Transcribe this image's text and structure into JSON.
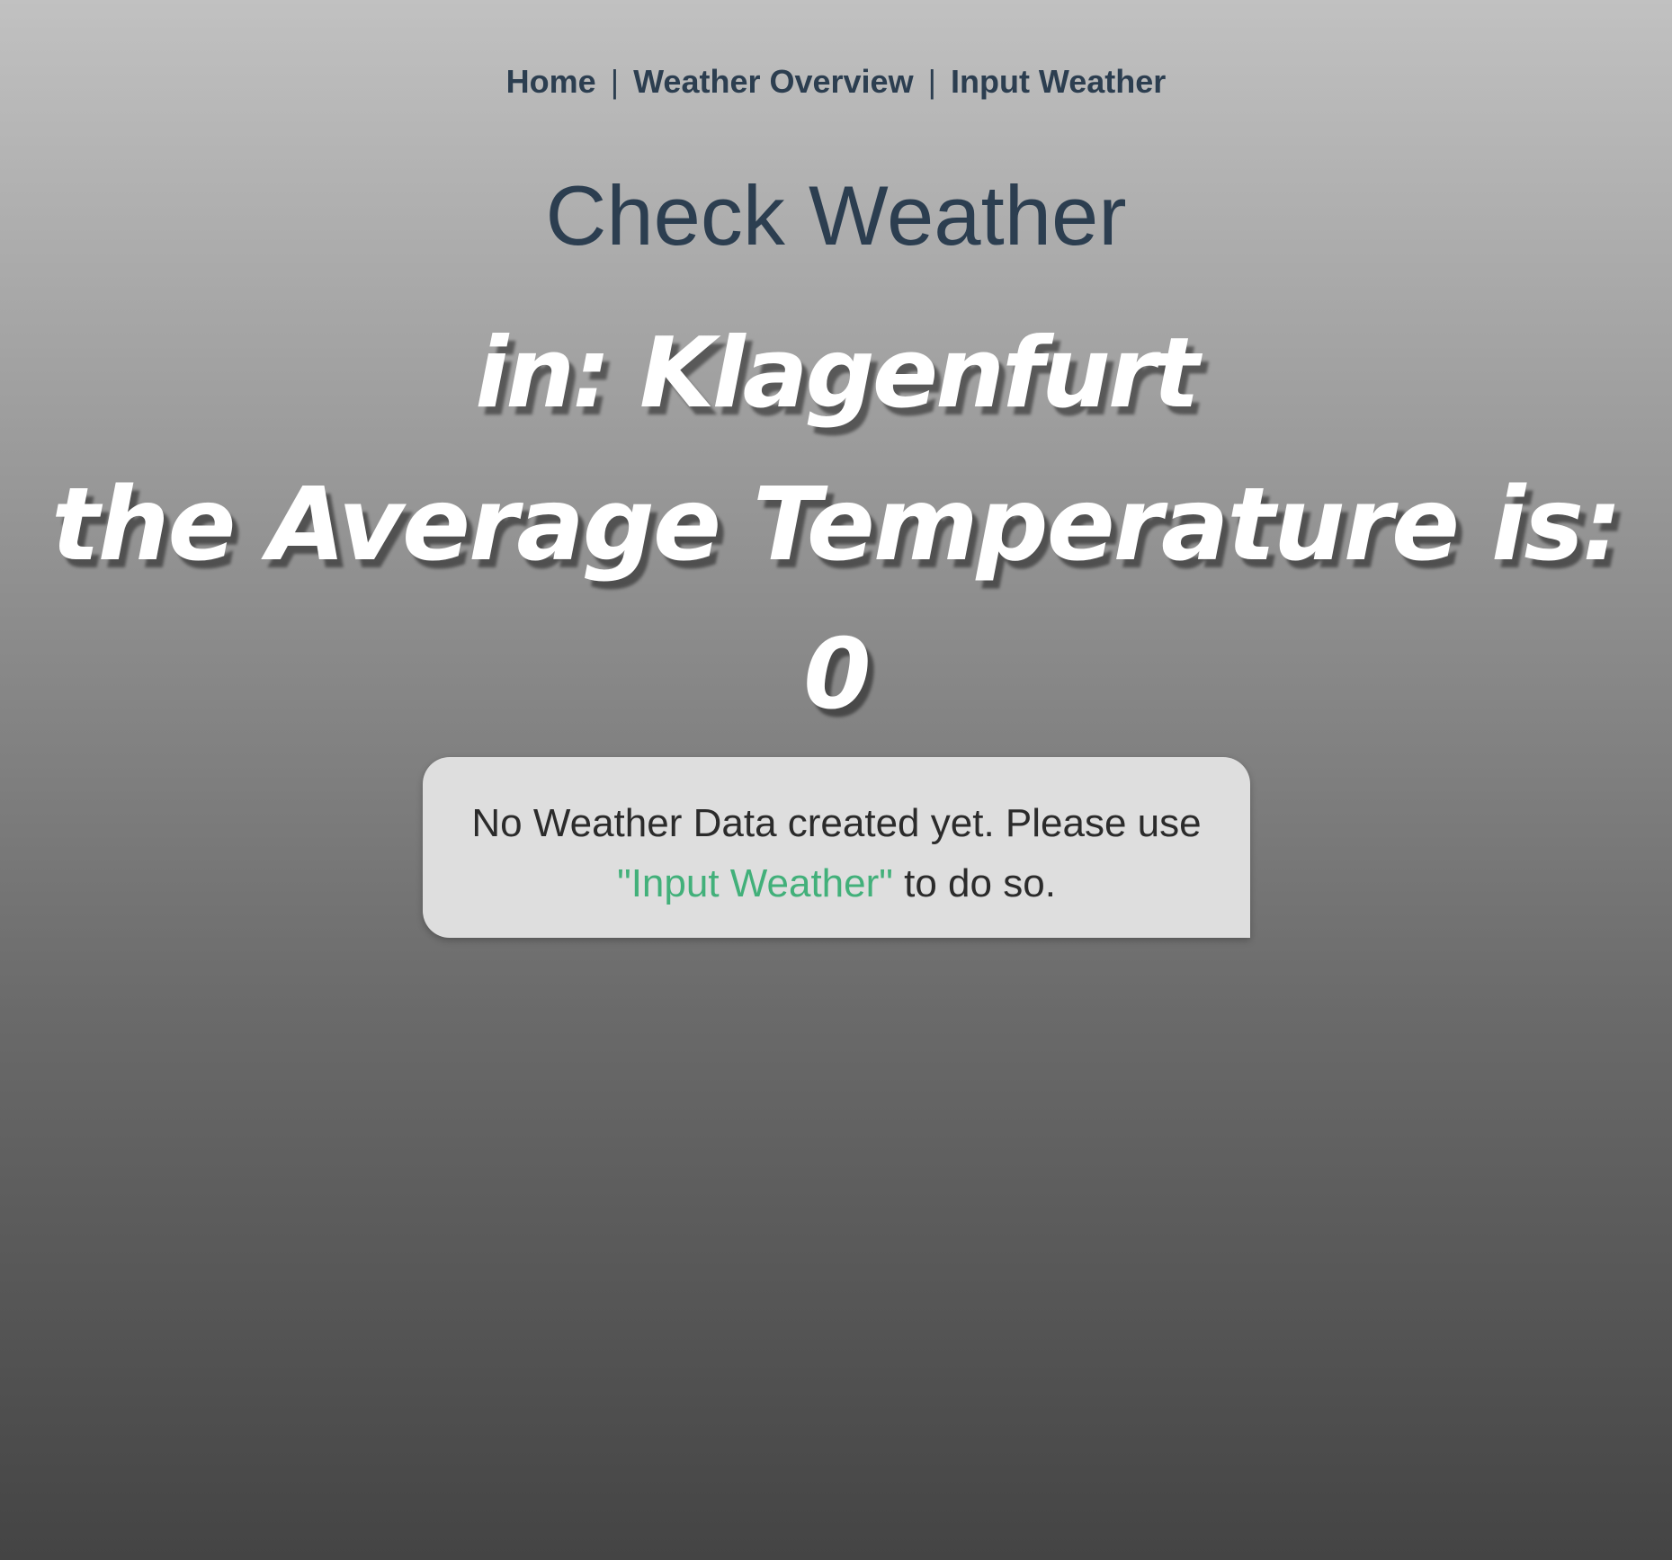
{
  "nav": {
    "home": "Home",
    "overview": "Weather Overview",
    "input": "Input Weather",
    "separator": "|"
  },
  "page_title": "Check Weather",
  "location": {
    "text": "in: Klagenfurt"
  },
  "temperature": {
    "label": "the Average Temperature is:",
    "value": "0"
  },
  "notice": {
    "text_before": "No Weather Data created yet. Please use",
    "link_text": "\"Input Weather\"",
    "text_after": " to do so."
  },
  "colors": {
    "heading": "#2c3e50",
    "link_accent": "#42b07a",
    "notice_bg": "#dedede"
  }
}
